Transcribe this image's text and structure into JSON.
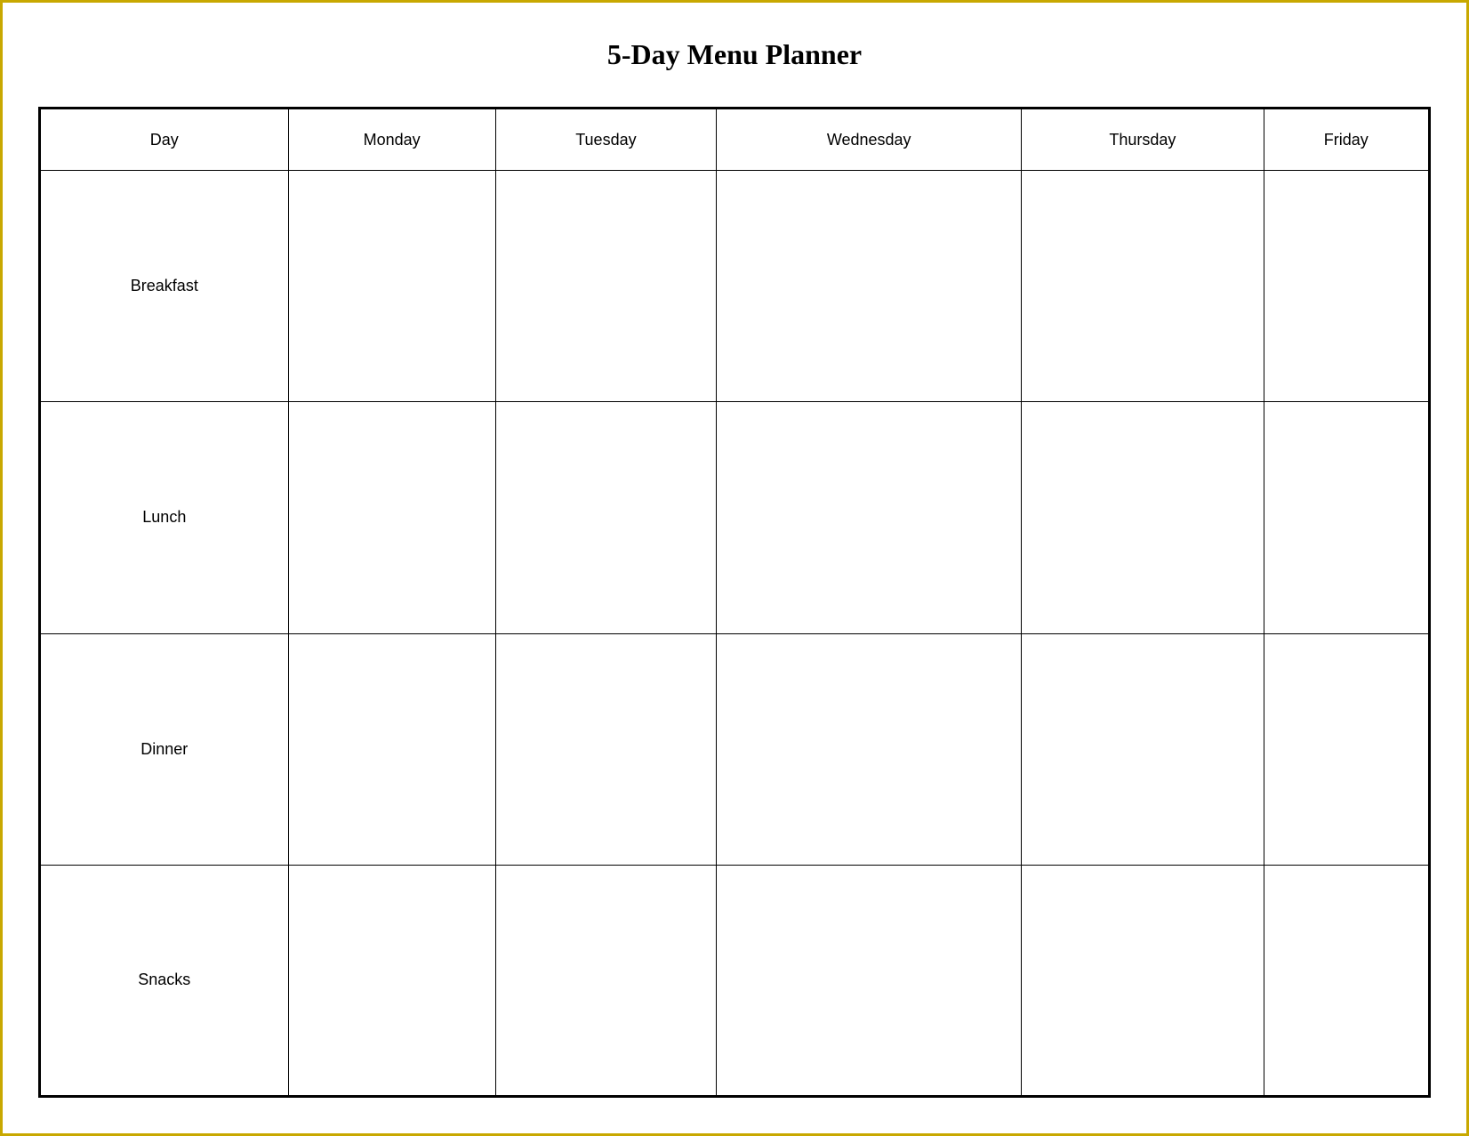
{
  "title": "5-Day Menu Planner",
  "table": {
    "headers": [
      "Day",
      "Monday",
      "Tuesday",
      "Wednesday",
      "Thursday",
      "Friday"
    ],
    "rows": [
      {
        "label": "Breakfast"
      },
      {
        "label": "Lunch"
      },
      {
        "label": "Dinner"
      },
      {
        "label": "Snacks"
      }
    ]
  }
}
